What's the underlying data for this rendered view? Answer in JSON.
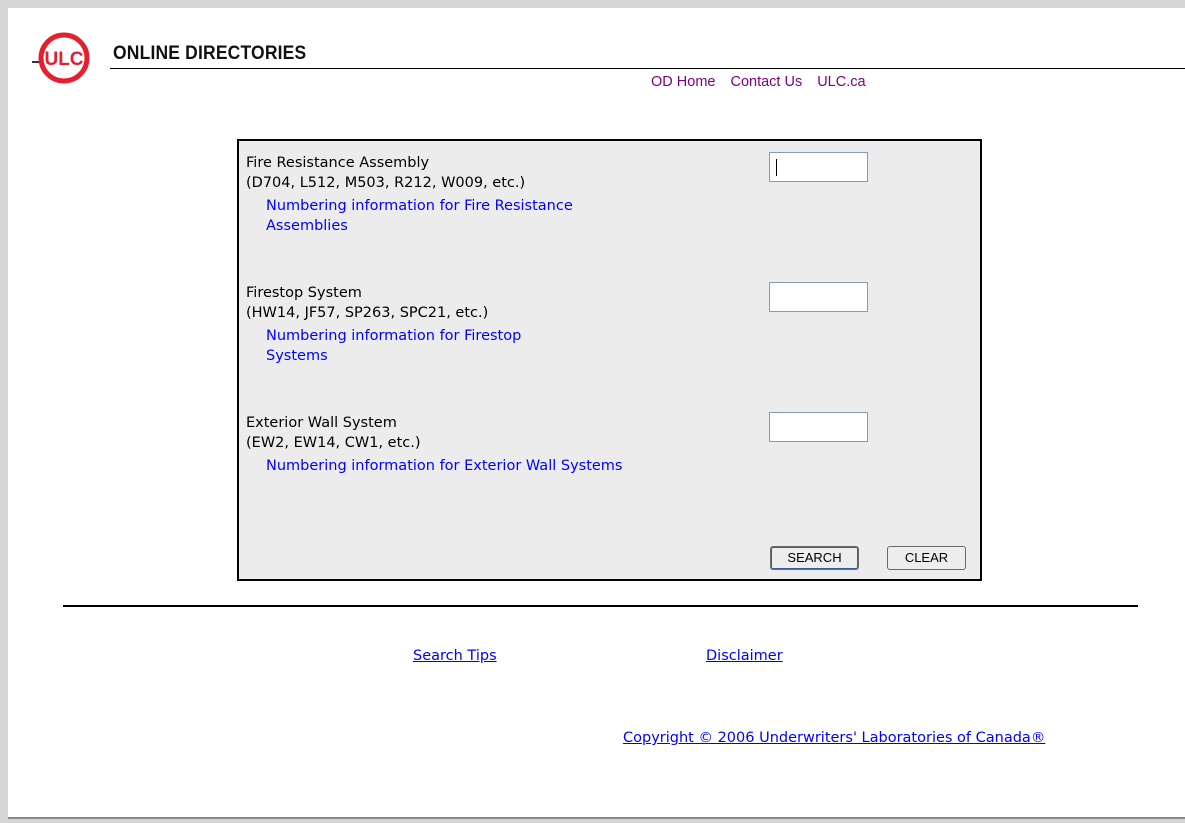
{
  "header": {
    "brand_title": "ONLINE DIRECTORIES",
    "logo_text": "ULC",
    "logo_color": "#e4202e",
    "nav": [
      "OD Home",
      "Contact Us",
      "ULC.ca"
    ]
  },
  "form": {
    "rows": [
      {
        "title": "Fire Resistance Assembly",
        "example": "(D704, L512, M503, R212, W009, etc.)",
        "link": "Numbering information for Fire Resistance Assemblies",
        "value": ""
      },
      {
        "title": "Firestop System",
        "example": "(HW14, JF57, SP263, SPC21, etc.)",
        "link": "Numbering information for Firestop Systems",
        "value": ""
      },
      {
        "title": "Exterior Wall System",
        "example": "(EW2, EW14, CW1, etc.)",
        "link": "Numbering information for Exterior Wall Systems",
        "value": ""
      }
    ],
    "search_label": "SEARCH",
    "clear_label": "CLEAR"
  },
  "footer": {
    "search_tips": "Search Tips",
    "disclaimer": "Disclaimer",
    "copyright": "Copyright © 2006 Underwriters' Laboratories of Canada®"
  },
  "colors": {
    "link": "#0000ff",
    "visited_link": "#800080",
    "form_background": "#ececec"
  }
}
